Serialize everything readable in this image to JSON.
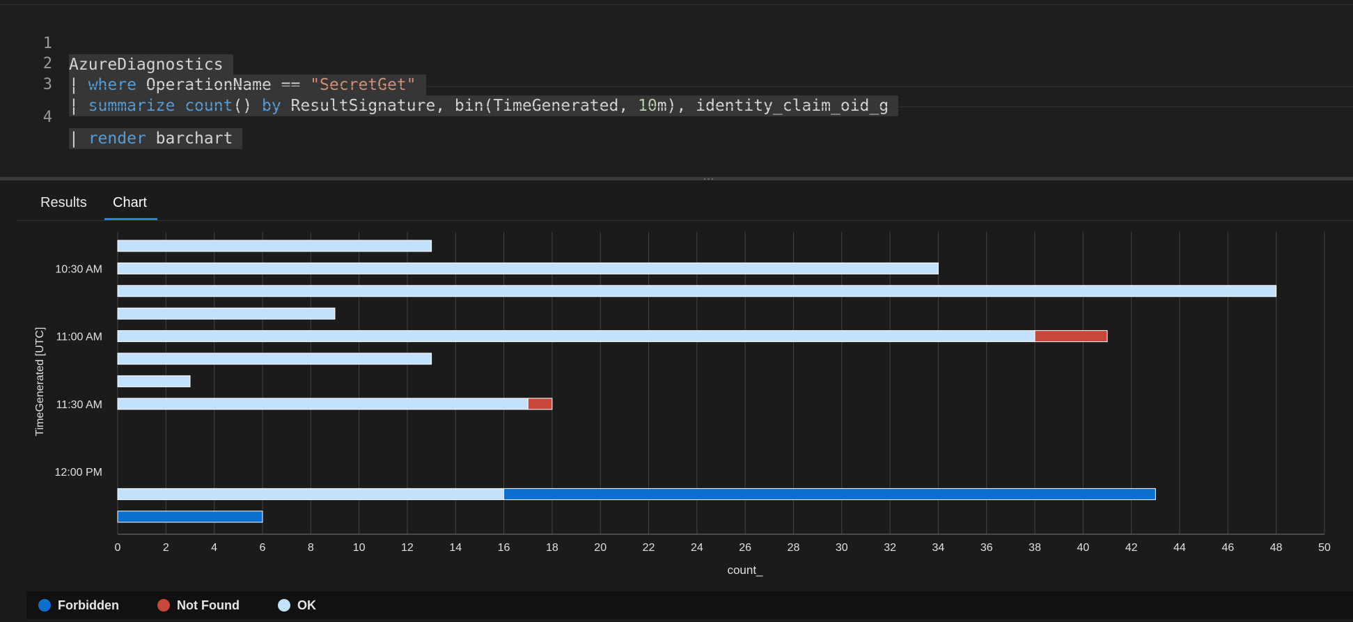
{
  "editor": {
    "lines": [
      {
        "number": "1"
      },
      {
        "number": "2"
      },
      {
        "number": "3"
      },
      {
        "number": "4"
      }
    ],
    "line1": {
      "table": "AzureDiagnostics"
    },
    "line2": {
      "pipe": "| ",
      "keyword": "where",
      "field": " OperationName == ",
      "value": "\"SecretGet\""
    },
    "line3": {
      "pipe": "| ",
      "keyword": "summarize",
      "space": " ",
      "function": "count",
      "paren": "() ",
      "by": "by",
      "fields_before_num": " ResultSignature, bin(TimeGenerated, ",
      "num": "10",
      "fields_after_num": "m), identity_claim_oid_g"
    },
    "line4": {
      "pipe": "| ",
      "keyword": "render",
      "visual": " barchart"
    }
  },
  "splitter": {
    "grip": "..."
  },
  "tabs": [
    {
      "label": "Results",
      "active": false
    },
    {
      "label": "Chart",
      "active": true
    }
  ],
  "colors": {
    "Forbidden": "#0a6fcf",
    "Not Found": "#c9473a",
    "OK": "#c3e0fd",
    "accent": "#2f80d8"
  },
  "chart_data": {
    "type": "bar",
    "orientation": "horizontal",
    "stacked": true,
    "xlabel": "count_",
    "ylabel": "TimeGenerated [UTC]",
    "xlim": [
      0,
      50
    ],
    "xticks": [
      0,
      2,
      4,
      6,
      8,
      10,
      12,
      14,
      16,
      18,
      20,
      22,
      24,
      26,
      28,
      30,
      32,
      34,
      36,
      38,
      40,
      42,
      44,
      46,
      48,
      50
    ],
    "ytick_labels": [
      "10:30 AM",
      "11:00 AM",
      "11:30 AM",
      "12:00 PM"
    ],
    "grid": true,
    "legend_position": "bottom-left",
    "categories": [
      "10:20",
      "10:30",
      "10:40",
      "10:50",
      "11:00",
      "11:10",
      "11:20",
      "11:30",
      "11:40",
      "11:50",
      "12:00",
      "12:10",
      "12:20"
    ],
    "series": [
      {
        "name": "OK",
        "values": [
          13,
          34,
          48,
          9,
          38,
          13,
          3,
          17,
          0,
          0,
          0,
          16,
          0
        ]
      },
      {
        "name": "Not Found",
        "values": [
          0,
          0,
          0,
          0,
          3,
          0,
          0,
          1,
          0,
          0,
          0,
          0,
          0
        ]
      },
      {
        "name": "Forbidden",
        "values": [
          0,
          0,
          0,
          0,
          0,
          0,
          0,
          0,
          0,
          0,
          0,
          27,
          6
        ]
      }
    ]
  },
  "legend": [
    {
      "label": "Forbidden"
    },
    {
      "label": "Not Found"
    },
    {
      "label": "OK"
    }
  ]
}
